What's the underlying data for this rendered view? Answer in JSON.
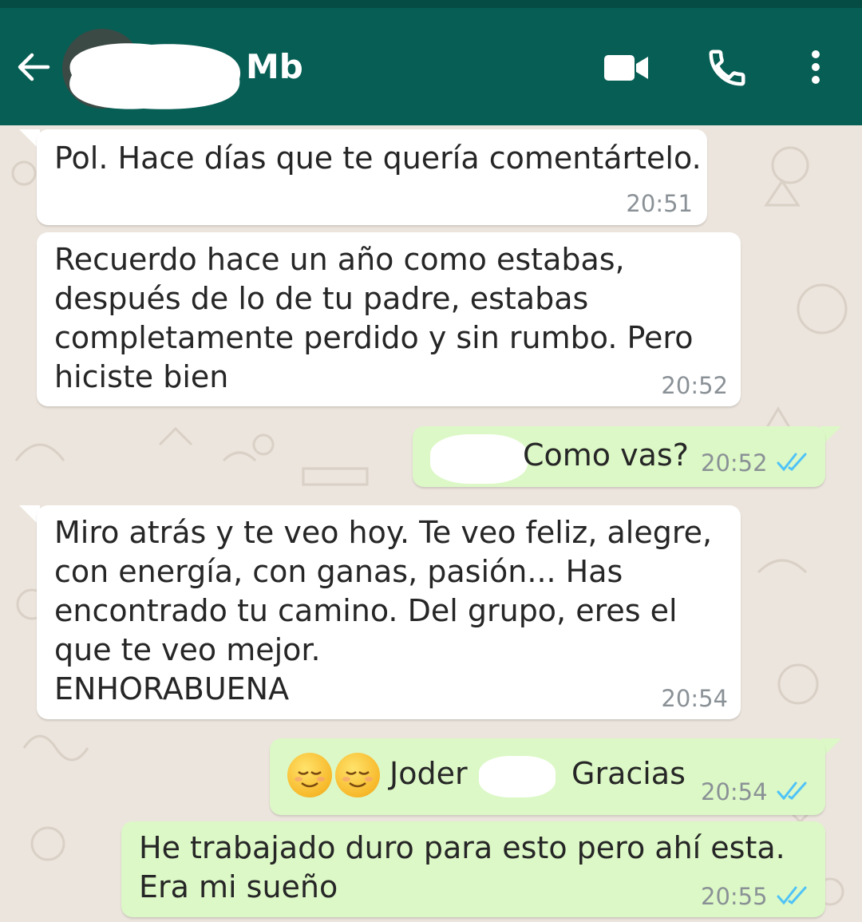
{
  "header": {
    "contact_name": "Mb",
    "back_icon": "back-arrow-icon",
    "video_icon": "video-camera-icon",
    "call_icon": "phone-icon",
    "menu_icon": "more-vert-icon",
    "bg_color": "#075e54"
  },
  "messages": [
    {
      "direction": "in",
      "text": "Pol. Hace días que te quería comentártelo.",
      "time": "20:51"
    },
    {
      "direction": "in",
      "text": "Recuerdo hace un año como estabas,\ndespués de lo de tu padre, estabas\ncompletamente perdido y sin rumbo. Pero\nhiciste bien",
      "time": "20:52"
    },
    {
      "direction": "out",
      "text": "Como vas?",
      "time": "20:52",
      "status": "read"
    },
    {
      "direction": "in",
      "text": "Miro atrás y te veo hoy. Te veo feliz, alegre,\ncon energía, con ganas, pasión... Has\nencontrado tu camino. Del grupo, eres el\nque te veo mejor.\nENHORABUENA",
      "time": "20:54"
    },
    {
      "direction": "out",
      "text_before": "Joder",
      "text_after": "Gracias",
      "emoji": [
        "relieved-face",
        "relieved-face"
      ],
      "time": "20:54",
      "status": "read"
    },
    {
      "direction": "out",
      "text": "He trabajado duro para esto pero ahí esta.\nEra mi sueño",
      "time": "20:55",
      "status": "read"
    }
  ],
  "colors": {
    "incoming_bubble": "#ffffff",
    "outgoing_bubble": "#dcf8c6",
    "read_ticks": "#4fc3f7",
    "chat_background": "#ece5dd"
  }
}
